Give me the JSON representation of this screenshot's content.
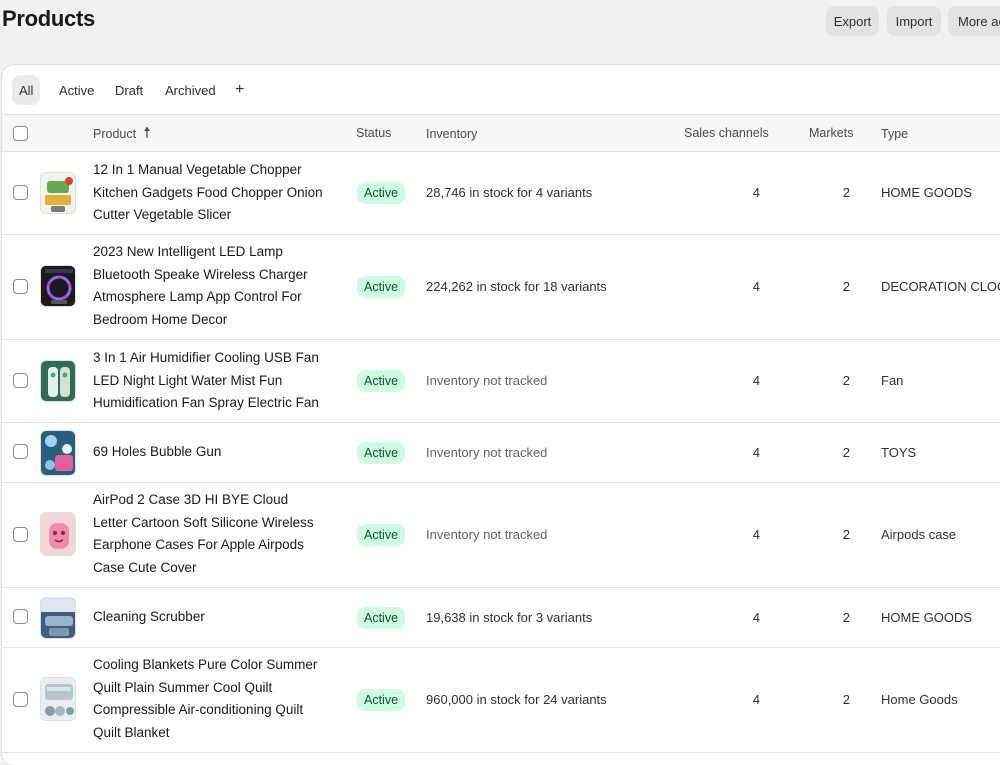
{
  "header": {
    "title": "Products",
    "export_label": "Export",
    "import_label": "Import",
    "more_label": "More ac"
  },
  "tabs": [
    {
      "label": "All",
      "selected": true
    },
    {
      "label": "Active"
    },
    {
      "label": "Draft"
    },
    {
      "label": "Archived"
    },
    {
      "label": "+"
    }
  ],
  "columns": {
    "product": "Product",
    "status": "Status",
    "inventory": "Inventory",
    "sales_channels": "Sales channels",
    "markets": "Markets",
    "type": "Type"
  },
  "rows": [
    {
      "name": "12 In 1 Manual Vegetable Chopper Kitchen Gadgets Food Chopper Onion Cutter Vegetable Slicer",
      "status": "Active",
      "inventory": "28,746 in stock for 4 variants",
      "inventory_tracked": true,
      "sales_channels": "4",
      "markets": "2",
      "type": "HOME GOODS"
    },
    {
      "name": "2023 New Intelligent LED Lamp Bluetooth Speake Wireless Charger Atmosphere Lamp App Control For Bedroom Home Decor",
      "status": "Active",
      "inventory": "224,262 in stock for 18 variants",
      "inventory_tracked": true,
      "sales_channels": "4",
      "markets": "2",
      "type": "DECORATION CLOCK"
    },
    {
      "name": "3 In 1 Air Humidifier Cooling USB Fan LED Night Light Water Mist Fun Humidification Fan Spray Electric Fan",
      "status": "Active",
      "inventory": "Inventory not tracked",
      "inventory_tracked": false,
      "sales_channels": "4",
      "markets": "2",
      "type": "Fan"
    },
    {
      "name": "69 Holes Bubble Gun",
      "status": "Active",
      "inventory": "Inventory not tracked",
      "inventory_tracked": false,
      "sales_channels": "4",
      "markets": "2",
      "type": "TOYS"
    },
    {
      "name": "AirPod 2 Case 3D HI BYE Cloud Letter Cartoon Soft Silicone Wireless Earphone Cases For Apple Airpods Case Cute Cover",
      "status": "Active",
      "inventory": "Inventory not tracked",
      "inventory_tracked": false,
      "sales_channels": "4",
      "markets": "2",
      "type": "Airpods case"
    },
    {
      "name": "Cleaning Scrubber",
      "status": "Active",
      "inventory": "19,638 in stock for 3 variants",
      "inventory_tracked": true,
      "sales_channels": "4",
      "markets": "2",
      "type": "HOME GOODS"
    },
    {
      "name": "Cooling Blankets Pure Color Summer Quilt Plain Summer Cool Quilt Compressible Air-conditioning Quilt Quilt Blanket",
      "status": "Active",
      "inventory": "960,000 in stock for 24 variants",
      "inventory_tracked": true,
      "sales_channels": "4",
      "markets": "2",
      "type": "Home Goods"
    }
  ],
  "colors": {
    "badge_bg": "#cdfee1",
    "badge_text": "#0c5132",
    "page_bg": "#f1f1f1"
  }
}
